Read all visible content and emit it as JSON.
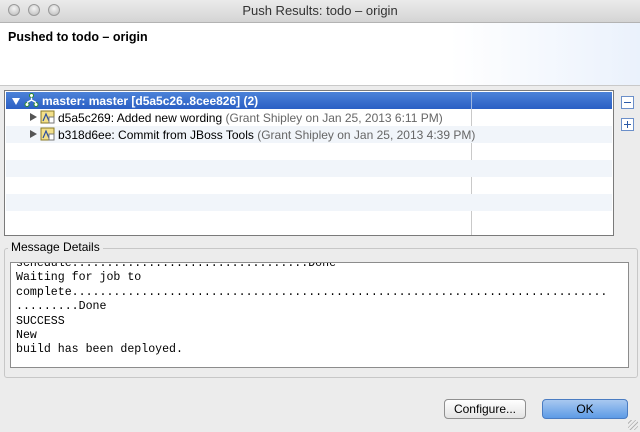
{
  "window": {
    "title": "Push Results: todo – origin",
    "header_title": "Pushed to todo – origin"
  },
  "tree": {
    "root": {
      "label": "master: master [d5a5c26..8cee826] (2)",
      "icon": "branch-icon",
      "expanded": true
    },
    "commits": [
      {
        "id_message": "d5a5c269: Added new wording",
        "meta": "(Grant Shipley on Jan 25, 2013 6:11 PM)",
        "icon": "commit-icon"
      },
      {
        "id_message": "b318d6ee: Commit from JBoss Tools",
        "meta": "(Grant Shipley on Jan 25, 2013 4:39 PM)",
        "icon": "commit-icon"
      }
    ],
    "side_buttons": [
      "collapse-all-icon",
      "expand-all-icon"
    ]
  },
  "message_details": {
    "label": "Message Details",
    "text": "schedule..................................Done\nWaiting for job to\ncomplete.............................................................................\n.........Done\nSUCCESS\nNew\nbuild has been deployed."
  },
  "buttons": {
    "configure": "Configure...",
    "ok": "OK"
  },
  "colors": {
    "selection": "#3a6fd0",
    "window_bg": "#ececec",
    "default_button": "#6fa5ea"
  }
}
